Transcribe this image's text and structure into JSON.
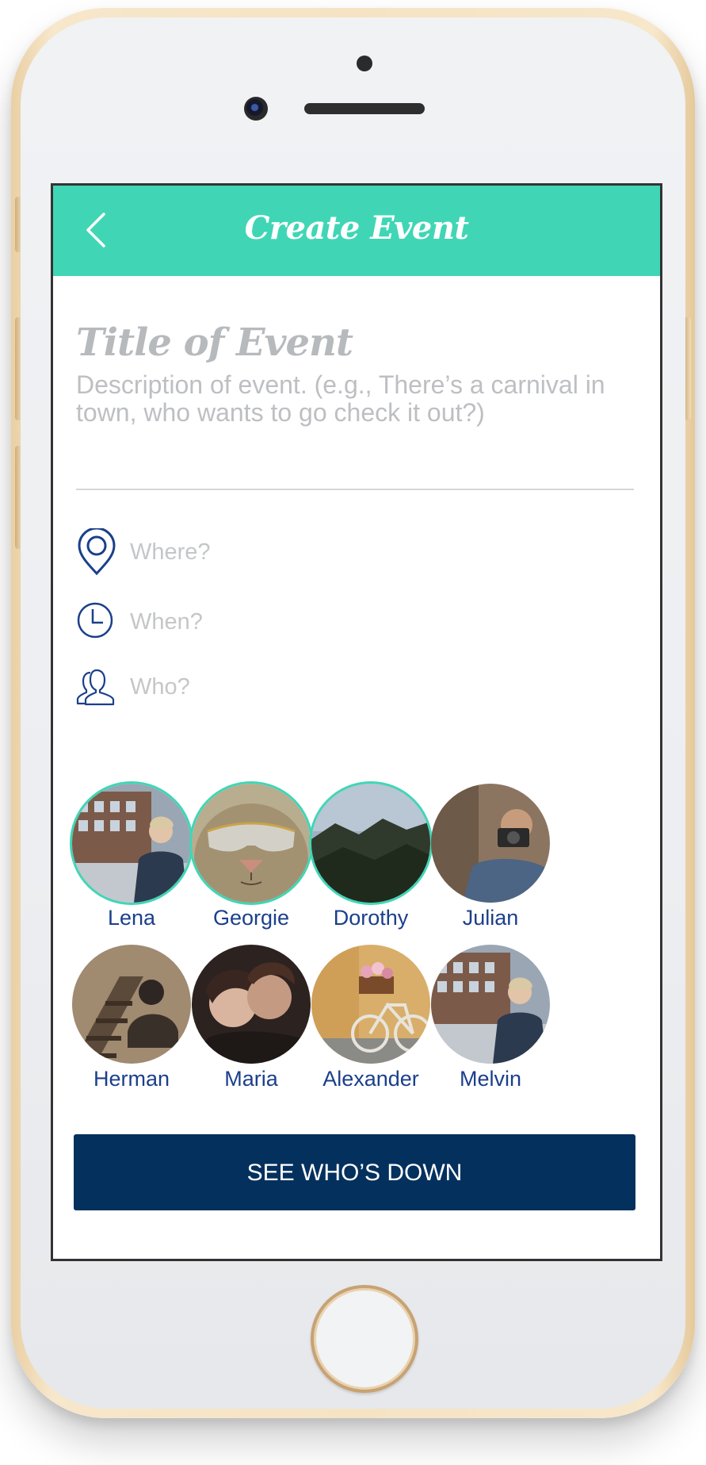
{
  "header": {
    "title": "Create Event",
    "back_icon": "chevron-left-icon"
  },
  "event": {
    "title_placeholder": "Title of Event",
    "description_placeholder": "Description of event. (e.g., There’s a carnival in town, who wants to go check it out?)"
  },
  "fields": {
    "where": {
      "label": "Where?",
      "icon": "location-pin-icon"
    },
    "when": {
      "label": "When?",
      "icon": "clock-icon"
    },
    "who": {
      "label": "Who?",
      "icon": "people-icon"
    }
  },
  "friends": [
    {
      "name": "Lena",
      "selected": true
    },
    {
      "name": "Georgie",
      "selected": true
    },
    {
      "name": "Dorothy",
      "selected": true
    },
    {
      "name": "Julian",
      "selected": false
    },
    {
      "name": "Herman",
      "selected": false
    },
    {
      "name": "Maria",
      "selected": false
    },
    {
      "name": "Alexander",
      "selected": false
    },
    {
      "name": "Melvin",
      "selected": false
    }
  ],
  "cta": {
    "label": "SEE WHO’S DOWN"
  },
  "colors": {
    "accent": "#40d6b5",
    "primary_dark": "#04305d",
    "name_text": "#1b3f8b",
    "placeholder": "#b7babd"
  }
}
